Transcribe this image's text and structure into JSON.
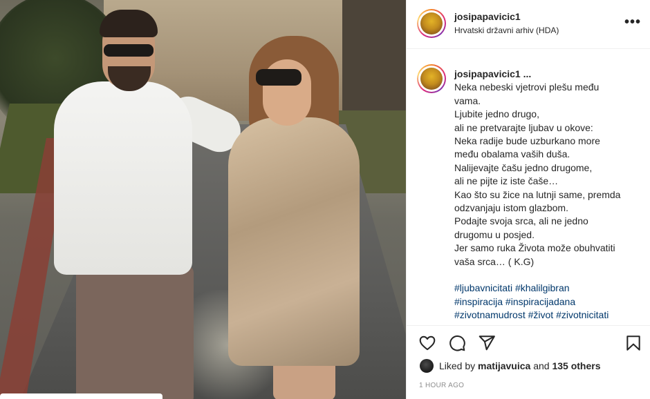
{
  "post": {
    "author": "josipapavicic1",
    "location": "Hrvatski državni arhiv (HDA)",
    "more_label": "•••"
  },
  "caption": {
    "username": "josipapavicic1",
    "username_suffix": " ...",
    "lines": [
      "Neka nebeski vjetrovi plešu među",
      "vama.",
      "Ljubite jedno drugo,",
      "ali ne pretvarajte ljubav u okove:",
      "Neka radije bude uzburkano more",
      "među obalama vaših duša.",
      "Nalijevajte čašu jedno drugome,",
      "ali ne pijte iz iste čaše…",
      "Kao što su žice na lutnji same, premda",
      "odzvanjaju istom glazbom.",
      "Podajte svoja srca, ali ne jedno",
      "drugomu u posjed.",
      "Jer samo ruka Života može obuhvatiti",
      "vaša srca… ( K.G)"
    ],
    "hashtags": [
      "#ljubavnicitati #khalilgibran",
      "#inspiracija #inspiracijadana",
      "#zivotnamudrost #život #zivotnicitati"
    ]
  },
  "actions": {
    "like_icon": "heart-icon",
    "comment_icon": "comment-icon",
    "share_icon": "paper-plane-icon",
    "save_icon": "bookmark-icon"
  },
  "likes": {
    "prefix": "Liked by ",
    "user": "matijavuica",
    "middle": " and ",
    "others": "135 others"
  },
  "timestamp": "1 HOUR AGO",
  "colors": {
    "text": "#262626",
    "hashtag": "#00376b",
    "muted": "#8e8e8e",
    "divider": "#efefef"
  }
}
